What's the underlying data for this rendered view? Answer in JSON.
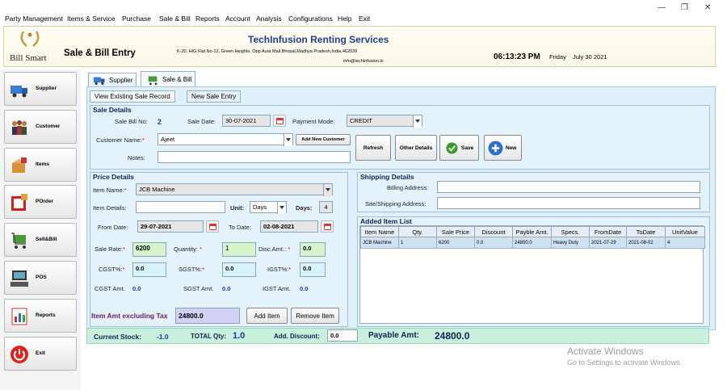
{
  "menu": [
    "Party Management",
    "Items & Service",
    "Purchase",
    "Sale & Bill",
    "Reports",
    "Account",
    "Analysis",
    "Configurations",
    "Help",
    "Exit"
  ],
  "window_controls": {
    "minimize": "—",
    "restore": "❐",
    "close": "✕"
  },
  "header": {
    "logo_text": "Bill Smart",
    "page_title": "Sale & Bill Entry",
    "company_name": "TechInfusion Renting Services",
    "company_address": "K-20, HIG Flat No-12, Green Heights, Opp Aura Mall,Bhopal,Madhya Pradesh,India,462039",
    "company_email": "info@techinfusion.in",
    "time": "06:13:23 PM",
    "day": "Friday",
    "date": "July 30 2021"
  },
  "sidebar": [
    {
      "label": "Supplier",
      "icon": "supplier-truck-icon"
    },
    {
      "label": "Customer",
      "icon": "customer-group-icon"
    },
    {
      "label": "Items",
      "icon": "items-box-icon"
    },
    {
      "label": "POrder",
      "icon": "purchase-order-icon"
    },
    {
      "label": "Sell&Bill",
      "icon": "cart-icon"
    },
    {
      "label": "POS",
      "icon": "pos-terminal-icon"
    },
    {
      "label": "Reports",
      "icon": "report-chart-icon"
    },
    {
      "label": "Exit",
      "icon": "power-icon"
    }
  ],
  "tabs": {
    "supplier": "Supplier",
    "sale_bill": "Sale & Bill"
  },
  "subtabs": {
    "view": "View Existing Sale Record",
    "new": "New Sale Entry"
  },
  "sale_details": {
    "title": "Sale Details",
    "bill_no_label": "Sale Bill No:",
    "bill_no": "2",
    "date_label": "Sale Date:",
    "date": "30-07-2021",
    "payment_label": "Payment Mode:",
    "payment": "CREDIT",
    "customer_label": "Customer Name:",
    "customer": "Ajeet",
    "notes_label": "Notes:",
    "notes": "",
    "add_customer": "Add New Customer",
    "refresh": "Refresh",
    "other": "Other Details",
    "save": "Save",
    "new": "New"
  },
  "price_details": {
    "title": "Price Details",
    "item_name_label": "Item Name:",
    "item_name": "JCB Machine",
    "item_details_label": "Item Details:",
    "item_details": "",
    "unit_label": "Unit:",
    "unit": "Days",
    "days_label": "Days:",
    "days": "4",
    "from_label": "From Date:",
    "from": "29-07-2021",
    "to_label": "To Date:",
    "to": "02-08-2021",
    "rate_label": "Sale Rate:",
    "rate": "6200",
    "qty_label": "Quantity:",
    "qty": "1",
    "disc_label": "Disc.Amt.:",
    "disc": "0.0",
    "cgst_label": "CGST%:",
    "cgst": "0.0",
    "sgst_label": "SGST%:",
    "sgst": "0.0",
    "igst_label": "IGST%:",
    "igst": "0.0",
    "cgst_amt_label": "CGST Amt.",
    "cgst_amt": "0.0",
    "sgst_amt_label": "SGST Amt.",
    "sgst_amt": "0.0",
    "igst_amt_label": "IGST Amt.",
    "igst_amt": "0.0",
    "item_amt_label": "Item Amt excluding Tax",
    "item_amt": "24800.0",
    "add_item": "Add Item",
    "remove_item": "Remove Item"
  },
  "shipping": {
    "title": "Shipping Details",
    "billing_label": "Billing Address:",
    "billing": "",
    "site_label": "Site/Shipping Address:",
    "site": ""
  },
  "added_items": {
    "title": "Added Item List",
    "columns": [
      "Item Name",
      "Qty.",
      "Sale Price",
      "Discount",
      "Payble Amt.",
      "Specs.",
      "FromDate",
      "ToDate",
      "UnitValue"
    ],
    "rows": [
      [
        "JCB Machine",
        "1",
        "6200",
        "0.0",
        "24800.0",
        "Heavy Duty",
        "2021-07-29",
        "2021-08-02",
        "4"
      ]
    ]
  },
  "footer": {
    "stock_label": "Current Stock:",
    "stock": "-1.0",
    "total_qty_label": "TOTAL Qty:",
    "total_qty": "1.0",
    "add_disc_label": "Add. Discount:",
    "add_disc": "0.0",
    "payable_label": "Payable Amt:",
    "payable": "24800.0"
  },
  "watermark": {
    "line1": "Activate Windows",
    "line2": "Go to Settings to activate Windows."
  }
}
